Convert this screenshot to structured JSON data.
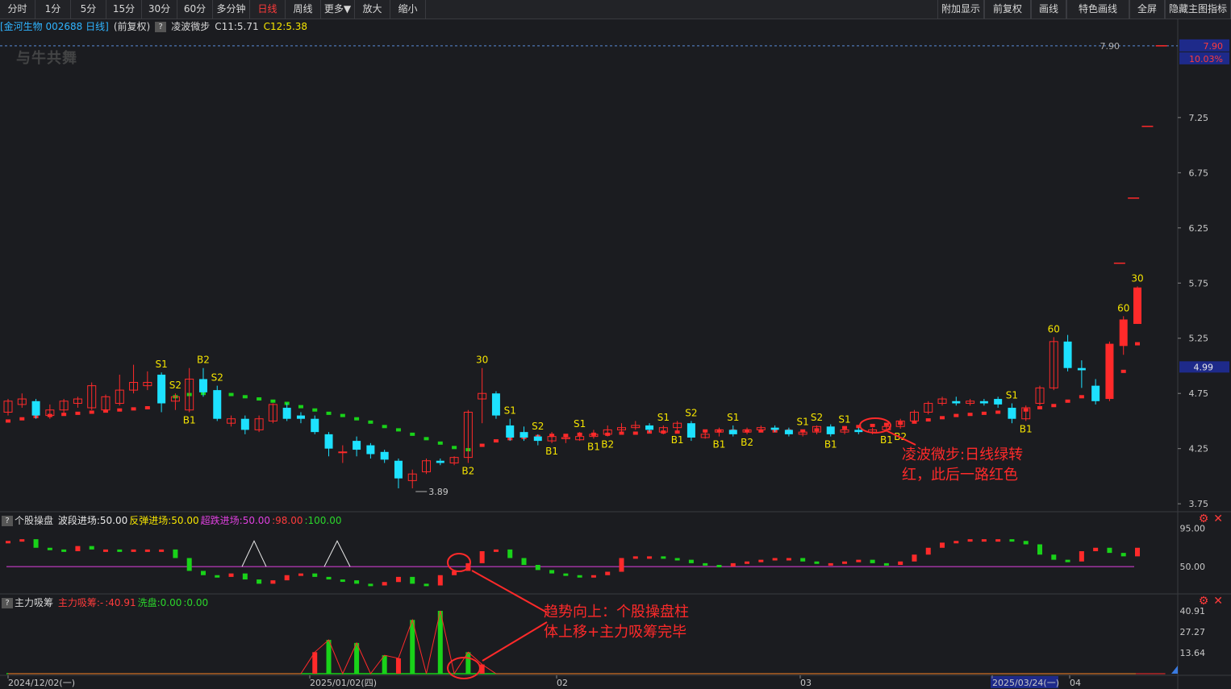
{
  "toolbar": {
    "left": [
      "分时",
      "1分",
      "5分",
      "15分",
      "30分",
      "60分",
      "多分钟",
      "日线",
      "周线",
      "更多▼",
      "放大",
      "缩小"
    ],
    "active": "日线",
    "right": [
      "附加显示",
      "前复权",
      "画线",
      "特色画线",
      "全屏",
      "隐藏主图指标"
    ]
  },
  "header": {
    "stock": "[金河生物 002688 日线]",
    "adjust": "(前复权)",
    "indicator": "凌波微步",
    "c11": "C11:5.71",
    "c12": "C12:5.38"
  },
  "logo": "与牛共舞",
  "main": {
    "ylabels": [
      "7.90",
      "10.03%",
      "7.25",
      "6.75",
      "6.25",
      "5.75",
      "5.25",
      "4.99",
      "4.75",
      "4.25",
      "3.75"
    ],
    "price_line_label": "7.90",
    "low_label": "3.89",
    "annotation": [
      "凌波微步:日线绿转",
      "红，此后一路红色"
    ]
  },
  "panel2": {
    "name": "个股操盘",
    "params": [
      {
        "text": "波段进场:50.00",
        "color": "#e8e8e8"
      },
      {
        "text": "反弹进场:50.00",
        "color": "#f5e400"
      },
      {
        "text": "超跌进场:50.00",
        "color": "#e040e0"
      },
      {
        "text": ":98.00",
        "color": "#ff3b3b"
      },
      {
        "text": ":100.00",
        "color": "#2bd62b"
      }
    ],
    "ylabels": [
      "95.00",
      "50.00"
    ]
  },
  "panel3": {
    "name": "主力吸筹",
    "params": [
      {
        "text": "主力吸筹:-",
        "color": "#ff3b3b"
      },
      {
        "text": ":40.91",
        "color": "#ff3b3b"
      },
      {
        "text": "洗盘:0.00",
        "color": "#2bd62b"
      },
      {
        "text": ":0.00",
        "color": "#2bd62b"
      }
    ],
    "ylabels": [
      "40.91",
      "27.27",
      "13.64"
    ],
    "annotation": [
      "趋势向上：个股操盘柱",
      "体上移+主力吸筹完毕"
    ]
  },
  "xaxis": {
    "labels": [
      "2024/12/02(一)",
      "2025/01/02(四)",
      "02",
      "03",
      "2025/03/24(一)",
      "04"
    ]
  },
  "colors": {
    "up": "#ff2a2a",
    "down": "#1de1ff",
    "green": "#19d219",
    "bg": "#1b1c20",
    "grid": "#3a3b40",
    "annot": "#ff2a2a"
  },
  "chart_data": {
    "type": "candlestick",
    "title": "金河生物 002688 日线",
    "ylim": [
      3.7,
      7.95
    ],
    "candles": [
      [
        4.58,
        4.68,
        4.7,
        4.55
      ],
      [
        4.65,
        4.7,
        4.75,
        4.62
      ],
      [
        4.68,
        4.55,
        4.7,
        4.52
      ],
      [
        4.55,
        4.6,
        4.65,
        4.52
      ],
      [
        4.6,
        4.68,
        4.7,
        4.56
      ],
      [
        4.66,
        4.7,
        4.72,
        4.62
      ],
      [
        4.62,
        4.82,
        4.85,
        4.6
      ],
      [
        4.6,
        4.72,
        4.74,
        4.58
      ],
      [
        4.66,
        4.78,
        4.92,
        4.64
      ],
      [
        4.78,
        4.85,
        5.01,
        4.75
      ],
      [
        4.82,
        4.85,
        4.95,
        4.78
      ],
      [
        4.92,
        4.66,
        4.94,
        4.58
      ],
      [
        4.68,
        4.72,
        4.75,
        4.6
      ],
      [
        4.6,
        4.88,
        4.98,
        4.58
      ],
      [
        4.88,
        4.76,
        4.98,
        4.72
      ],
      [
        4.78,
        4.52,
        4.82,
        4.5
      ],
      [
        4.48,
        4.52,
        4.55,
        4.45
      ],
      [
        4.52,
        4.42,
        4.55,
        4.38
      ],
      [
        4.42,
        4.52,
        4.55,
        4.4
      ],
      [
        4.5,
        4.65,
        4.66,
        4.48
      ],
      [
        4.62,
        4.52,
        4.66,
        4.5
      ],
      [
        4.55,
        4.52,
        4.58,
        4.48
      ],
      [
        4.52,
        4.4,
        4.55,
        4.38
      ],
      [
        4.38,
        4.25,
        4.4,
        4.18
      ],
      [
        4.22,
        4.22,
        4.28,
        4.12
      ],
      [
        4.32,
        4.24,
        4.36,
        4.18
      ],
      [
        4.28,
        4.2,
        4.3,
        4.16
      ],
      [
        4.22,
        4.15,
        4.24,
        4.12
      ],
      [
        4.14,
        3.98,
        4.16,
        3.89
      ],
      [
        3.96,
        4.02,
        4.06,
        3.89
      ],
      [
        4.04,
        4.14,
        4.16,
        4.02
      ],
      [
        4.14,
        4.12,
        4.16,
        4.1
      ],
      [
        4.12,
        4.17,
        4.18,
        4.1
      ],
      [
        4.17,
        4.58,
        4.6,
        4.12
      ],
      [
        4.7,
        4.75,
        4.98,
        4.48
      ],
      [
        4.75,
        4.55,
        4.77,
        4.52
      ],
      [
        4.46,
        4.35,
        4.52,
        4.32
      ],
      [
        4.4,
        4.35,
        4.45,
        4.32
      ],
      [
        4.36,
        4.32,
        4.38,
        4.28
      ],
      [
        4.32,
        4.36,
        4.4,
        4.3
      ],
      [
        4.34,
        4.35,
        4.38,
        4.3
      ],
      [
        4.33,
        4.36,
        4.4,
        4.32
      ],
      [
        4.36,
        4.38,
        4.42,
        4.34
      ],
      [
        4.38,
        4.42,
        4.46,
        4.36
      ],
      [
        4.42,
        4.44,
        4.48,
        4.4
      ],
      [
        4.44,
        4.46,
        4.5,
        4.42
      ],
      [
        4.46,
        4.42,
        4.48,
        4.4
      ],
      [
        4.4,
        4.44,
        4.46,
        4.38
      ],
      [
        4.44,
        4.48,
        4.5,
        4.4
      ],
      [
        4.48,
        4.35,
        4.5,
        4.32
      ],
      [
        4.35,
        4.38,
        4.42,
        4.34
      ],
      [
        4.4,
        4.42,
        4.44,
        4.36
      ],
      [
        4.42,
        4.38,
        4.46,
        4.36
      ],
      [
        4.4,
        4.42,
        4.44,
        4.38
      ],
      [
        4.42,
        4.44,
        4.46,
        4.4
      ],
      [
        4.44,
        4.42,
        4.46,
        4.4
      ],
      [
        4.42,
        4.38,
        4.44,
        4.36
      ],
      [
        4.38,
        4.4,
        4.42,
        4.36
      ],
      [
        4.4,
        4.45,
        4.46,
        4.38
      ],
      [
        4.45,
        4.38,
        4.47,
        4.36
      ],
      [
        4.4,
        4.42,
        4.44,
        4.38
      ],
      [
        4.42,
        4.4,
        4.44,
        4.38
      ],
      [
        4.4,
        4.42,
        4.44,
        4.38
      ],
      [
        4.42,
        4.45,
        4.48,
        4.4
      ],
      [
        4.45,
        4.5,
        4.52,
        4.43
      ],
      [
        4.5,
        4.58,
        4.6,
        4.48
      ],
      [
        4.58,
        4.66,
        4.68,
        4.56
      ],
      [
        4.66,
        4.7,
        4.72,
        4.64
      ],
      [
        4.68,
        4.66,
        4.72,
        4.64
      ],
      [
        4.66,
        4.68,
        4.7,
        4.64
      ],
      [
        4.68,
        4.66,
        4.7,
        4.64
      ],
      [
        4.7,
        4.65,
        4.72,
        4.62
      ],
      [
        4.62,
        4.52,
        4.66,
        4.48
      ],
      [
        4.52,
        4.62,
        4.64,
        4.5
      ],
      [
        4.66,
        4.8,
        4.82,
        4.64
      ],
      [
        4.8,
        5.22,
        5.26,
        4.78
      ],
      [
        5.22,
        4.98,
        5.28,
        4.95
      ],
      [
        4.98,
        4.96,
        5.05,
        4.8
      ],
      [
        4.82,
        4.68,
        4.88,
        4.65
      ],
      [
        4.7,
        5.2,
        5.22,
        4.68
      ],
      [
        5.18,
        5.42,
        5.45,
        5.1
      ],
      [
        5.38,
        5.71,
        5.72,
        5.38
      ]
    ],
    "wave_step": [
      4.5,
      4.52,
      4.54,
      4.55,
      4.56,
      4.57,
      4.58,
      4.59,
      4.6,
      4.61,
      4.62,
      4.7,
      4.72,
      4.74,
      4.75,
      4.76,
      4.74,
      4.72,
      4.7,
      4.68,
      4.66,
      4.63,
      4.6,
      4.57,
      4.55,
      4.52,
      4.49,
      4.45,
      4.42,
      4.38,
      4.34,
      4.3,
      4.26,
      4.24,
      4.28,
      4.32,
      4.34,
      4.35,
      4.36,
      4.37,
      4.37,
      4.38,
      4.38,
      4.38,
      4.39,
      4.39,
      4.4,
      4.4,
      4.4,
      4.4,
      4.41,
      4.41,
      4.41,
      4.41,
      4.41,
      4.41,
      4.41,
      4.41,
      4.42,
      4.43,
      4.44,
      4.45,
      4.46,
      4.47,
      4.48,
      4.49,
      4.51,
      4.53,
      4.55,
      4.56,
      4.57,
      4.58,
      4.59,
      4.6,
      4.62,
      4.64,
      4.68,
      4.72,
      4.78,
      4.85,
      4.95,
      5.2,
      5.4,
      5.7
    ],
    "wave_green_range": [
      12,
      33
    ],
    "markers": [
      {
        "label": "S1",
        "idx": 11,
        "pos": "above"
      },
      {
        "label": "S2",
        "idx": 12,
        "pos": "above"
      },
      {
        "label": "B1",
        "idx": 13,
        "pos": "below"
      },
      {
        "label": "B2",
        "idx": 14,
        "pos": "above"
      },
      {
        "label": "S2",
        "idx": 15,
        "pos": "above"
      },
      {
        "label": "30",
        "idx": 34,
        "pos": "above"
      },
      {
        "label": "B2",
        "idx": 33,
        "pos": "below"
      },
      {
        "label": "S1",
        "idx": 36,
        "pos": "above"
      },
      {
        "label": "S2",
        "idx": 38,
        "pos": "above"
      },
      {
        "label": "B1",
        "idx": 39,
        "pos": "below"
      },
      {
        "label": "S1",
        "idx": 41,
        "pos": "above"
      },
      {
        "label": "B1",
        "idx": 42,
        "pos": "below"
      },
      {
        "label": "B2",
        "idx": 43,
        "pos": "below"
      },
      {
        "label": "S1",
        "idx": 47,
        "pos": "above"
      },
      {
        "label": "B1",
        "idx": 48,
        "pos": "below"
      },
      {
        "label": "S2",
        "idx": 49,
        "pos": "above"
      },
      {
        "label": "B1",
        "idx": 51,
        "pos": "below"
      },
      {
        "label": "S1",
        "idx": 52,
        "pos": "above"
      },
      {
        "label": "B2",
        "idx": 53,
        "pos": "below"
      },
      {
        "label": "S1",
        "idx": 57,
        "pos": "above"
      },
      {
        "label": "S2",
        "idx": 58,
        "pos": "above"
      },
      {
        "label": "B1",
        "idx": 59,
        "pos": "below"
      },
      {
        "label": "S1",
        "idx": 60,
        "pos": "above"
      },
      {
        "label": "B1",
        "idx": 63,
        "pos": "below"
      },
      {
        "label": "B2",
        "idx": 64,
        "pos": "below"
      },
      {
        "label": "S1",
        "idx": 72,
        "pos": "above"
      },
      {
        "label": "B1",
        "idx": 73,
        "pos": "below"
      },
      {
        "label": "60",
        "idx": 75,
        "pos": "above"
      },
      {
        "label": "60",
        "idx": 80,
        "pos": "above"
      },
      {
        "label": "30",
        "idx": 81,
        "pos": "above"
      }
    ],
    "limit_up_dashes": [
      5.93,
      6.52,
      7.17,
      7.9
    ],
    "panel2_values": [
      80,
      82,
      72,
      70,
      68,
      74,
      70,
      70,
      68,
      70,
      70,
      70,
      60,
      45,
      40,
      38,
      42,
      35,
      30,
      34,
      40,
      42,
      38,
      35,
      34,
      30,
      28,
      32,
      38,
      30,
      28,
      40,
      45,
      54,
      68,
      70,
      60,
      52,
      46,
      42,
      40,
      38,
      40,
      44,
      60,
      62,
      62,
      60,
      58,
      54,
      52,
      50,
      54,
      56,
      58,
      60,
      60,
      56,
      54,
      54,
      56,
      58,
      54,
      52,
      56,
      64,
      72,
      78,
      80,
      82,
      82,
      82,
      80,
      76,
      64,
      58,
      56,
      68,
      72,
      66,
      62,
      72,
      88,
      90,
      92,
      94
    ],
    "panel2_line": 50,
    "panel3_values": [
      0,
      0,
      0,
      0,
      0,
      0,
      0,
      0,
      0,
      0,
      0,
      0,
      0,
      0,
      0,
      0,
      0,
      0,
      0,
      0,
      0,
      0,
      0,
      0,
      0,
      0,
      0,
      0,
      0,
      0,
      0,
      0,
      0,
      0,
      0,
      0,
      0,
      0,
      0,
      0,
      0,
      0,
      0,
      0,
      0,
      0,
      0,
      0,
      0,
      0,
      0,
      0,
      0,
      0,
      0,
      0,
      0,
      0,
      0,
      0,
      0,
      0,
      0,
      0,
      0,
      0,
      0,
      0,
      0,
      0,
      0,
      0,
      0,
      0,
      0,
      0,
      0,
      0,
      0,
      0,
      0,
      0,
      0,
      0
    ],
    "panel3_bars": [
      0,
      0,
      0,
      0,
      0,
      0,
      0,
      0,
      0,
      0,
      0,
      0,
      0,
      0,
      0,
      0,
      0,
      0,
      0,
      0,
      0,
      0,
      14,
      22,
      0,
      20,
      0,
      12,
      10,
      35,
      0,
      40.91,
      0,
      14,
      6,
      0,
      0,
      0,
      0,
      0,
      0,
      0,
      0,
      0,
      0,
      0,
      0,
      0,
      0,
      0,
      0,
      0,
      0,
      0,
      0,
      0,
      0,
      0,
      0,
      0,
      0,
      0,
      0,
      0,
      0,
      0,
      0,
      0,
      0,
      0,
      0,
      0,
      0,
      0,
      0,
      0,
      0,
      0,
      0,
      0,
      0,
      0,
      0,
      0
    ],
    "panel3_ylim": [
      0,
      40.91
    ]
  }
}
